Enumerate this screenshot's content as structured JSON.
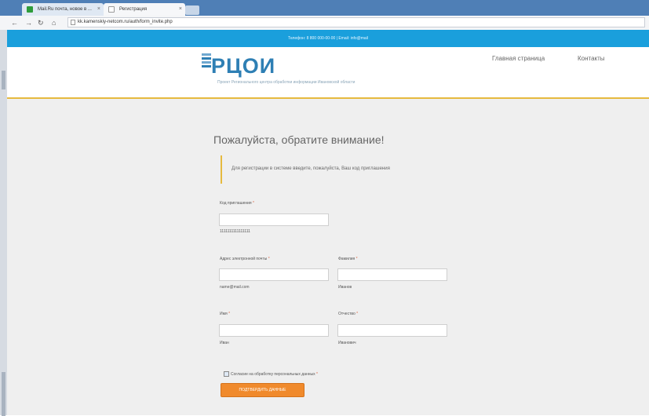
{
  "browser": {
    "tabs": [
      {
        "title": "Mail.Ru почта, новое в ...",
        "fav_color": "#2e9c3a"
      },
      {
        "title": "Регистрация",
        "fav_color": "#ffffff"
      }
    ],
    "url": "kk.kamenskiy-netcom.ru/auth/form_invite.php"
  },
  "site": {
    "infobar": "Телефон: 8 800 000-00-00 | Email: info@mail",
    "logo": "РЦОИ",
    "logo_subtitle": "Проект Регионального центра обработки информации Ивановской области",
    "nav": {
      "home": "Главная страница",
      "contacts": "Контакты"
    }
  },
  "form": {
    "title": "Пожалуйста, обратите внимание!",
    "notice": "Для регистрации в системе введите, пожалуйста, Ваш код приглашения",
    "invite_label": "Код приглашения",
    "invite_hint": "1111111111111111",
    "email_label": "Адрес электронной почты",
    "email_hint": "name@mail.com",
    "lastname_label": "Фамилия",
    "lastname_hint": "Иванов",
    "firstname_label": "Имя",
    "firstname_hint": "Иван",
    "patronymic_label": "Отчество",
    "patronymic_hint": "Иванович",
    "required_mark": "*",
    "consent_label": "Согласие на обработку персональных данных",
    "submit_label": "Подтвердить данные"
  }
}
